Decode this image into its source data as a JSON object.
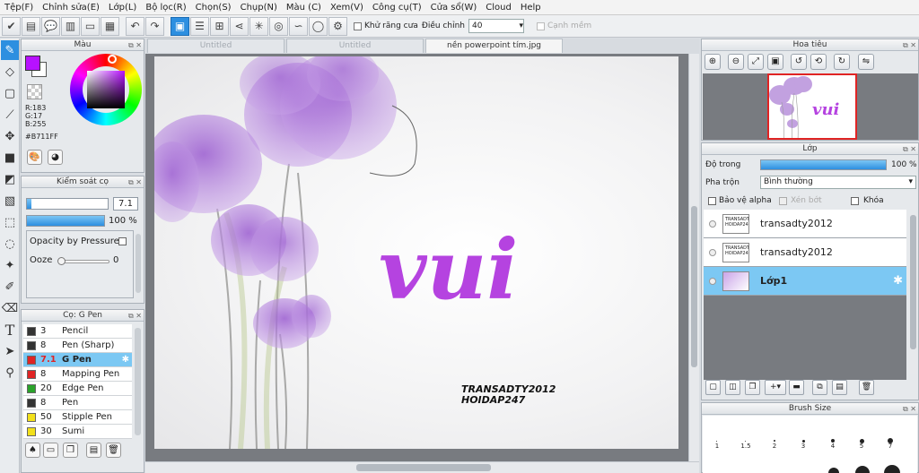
{
  "menu": [
    "Tệp(F)",
    "Chỉnh sửa(E)",
    "Lớp(L)",
    "Bộ lọc(R)",
    "Chọn(S)",
    "Chụp(N)",
    "Màu (C)",
    "Xem(V)",
    "Công cụ(T)",
    "Cửa sổ(W)",
    "Cloud",
    "Help"
  ],
  "toolbar": {
    "antialias_label": "Khử răng cưa",
    "adjust_label": "Điều chỉnh",
    "adjust_value": "40",
    "sharp_edge_label": "Cạnh mềm"
  },
  "color_panel": {
    "title": "Màu",
    "r": "R:183",
    "g": "G:17",
    "b": "B:255",
    "hex": "#B711FF",
    "current_color": "#b711ff"
  },
  "brush_control": {
    "title": "Kiểm soát cọ",
    "size": "7.1",
    "size_fraction": 0.05,
    "opacity": "100 %",
    "opacity_fraction": 1.0,
    "opacity_pressure_label": "Opacity by Pressure",
    "ooze_label": "Ooze",
    "ooze_value": "0"
  },
  "brush_list": {
    "title": "Cọ: G Pen",
    "items": [
      {
        "size": "3",
        "name": "Pencil",
        "color": "#333333"
      },
      {
        "size": "8",
        "name": "Pen (Sharp)",
        "color": "#333333"
      },
      {
        "size": "7.1",
        "name": "G Pen",
        "color": "#e02424"
      },
      {
        "size": "8",
        "name": "Mapping Pen",
        "color": "#e02424"
      },
      {
        "size": "20",
        "name": "Edge Pen",
        "color": "#2aa32a"
      },
      {
        "size": "8",
        "name": "Pen",
        "color": "#333333"
      },
      {
        "size": "50",
        "name": "Stipple Pen",
        "color": "#f2e01b"
      },
      {
        "size": "30",
        "name": "Sumi",
        "color": "#f2e01b"
      }
    ]
  },
  "tabs": [
    "Untitled",
    "Untitled",
    "nền powerpoint tím.jpg"
  ],
  "canvas": {
    "script_text": "vui",
    "caption_line1": "TRANSADTY2012",
    "caption_line2": "HOIDAP247"
  },
  "navigator": {
    "title": "Hoa tiêu",
    "preview_text": "vui"
  },
  "layer_panel": {
    "title": "Lớp",
    "opacity_label": "Độ trong",
    "opacity_value": "100 %",
    "blend_label": "Pha trộn",
    "blend_value": "Bình thường",
    "protect_alpha": "Bảo vệ alpha",
    "clipping": "Xén bớt",
    "lock": "Khóa",
    "layers": [
      {
        "name": "transadty2012",
        "thumb": "TRANSADTY2012 HOIDAP247"
      },
      {
        "name": "transadty2012",
        "thumb": "TRANSADTY2012 HOIDAP247"
      },
      {
        "name": "Lớp1",
        "thumb": ""
      }
    ]
  },
  "brush_size_panel": {
    "title": "Brush Size",
    "sizes": [
      "1",
      "1.5",
      "2",
      "3",
      "4",
      "5",
      "7"
    ]
  }
}
